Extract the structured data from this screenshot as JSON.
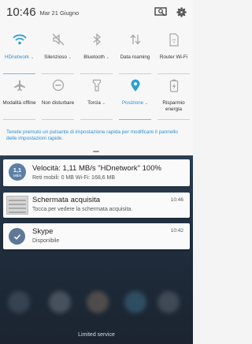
{
  "status_bar": {
    "time": "10:46",
    "date": "Mar 21 Giugno",
    "icons": [
      "screen-capture-icon",
      "settings-gear-icon"
    ]
  },
  "quick_settings": [
    {
      "label": "HDnetwork",
      "chevron": "⌄",
      "icon": "wifi-icon",
      "active": true
    },
    {
      "label": "Silenzioso",
      "chevron": "⌄",
      "icon": "mute-icon",
      "active": false
    },
    {
      "label": "Bluetooth",
      "chevron": "⌄",
      "icon": "bluetooth-icon",
      "active": false
    },
    {
      "label": "Data roaming",
      "chevron": "",
      "icon": "data-roaming-icon",
      "active": false
    },
    {
      "label": "Router Wi-Fi",
      "chevron": "",
      "icon": "hotspot-icon",
      "active": false
    },
    {
      "label": "Modalità offline",
      "chevron": "",
      "icon": "airplane-icon",
      "active": false
    },
    {
      "label": "Non disturbare",
      "chevron": "",
      "icon": "do-not-disturb-icon",
      "active": false
    },
    {
      "label": "Torcia",
      "chevron": "⌄",
      "icon": "flashlight-icon",
      "active": false
    },
    {
      "label": "Posizione",
      "chevron": "⌄",
      "icon": "location-icon",
      "active": true
    },
    {
      "label": "Risparmio energia",
      "chevron": "",
      "icon": "power-saving-icon",
      "active": false
    }
  ],
  "hint": "Tenete premuto un pulsante di impostazione rapida per modificare il pannello delle impostazioni rapide.",
  "notifications": {
    "speed": {
      "avatar_line1": "1,1",
      "avatar_line2": "MB/s",
      "title": "Velocità: 1,11 MB/s  \"HDnetwork\" 100%",
      "subtitle": "Reti mobili: 0 MB   Wi-Fi: 168,6 MB"
    },
    "screenshot": {
      "title": "Schermata acquisita",
      "subtitle": "Tocca per vedere la schermata acquisita.",
      "time": "10:46"
    },
    "skype": {
      "title": "Skype",
      "subtitle": "Disponibile",
      "time": "10:42"
    }
  },
  "bottom_status": "Limited service",
  "colors": {
    "accent": "#2e8fd6",
    "active_tile": "#2aa1d4",
    "inactive_icon": "#a7a7a7"
  }
}
